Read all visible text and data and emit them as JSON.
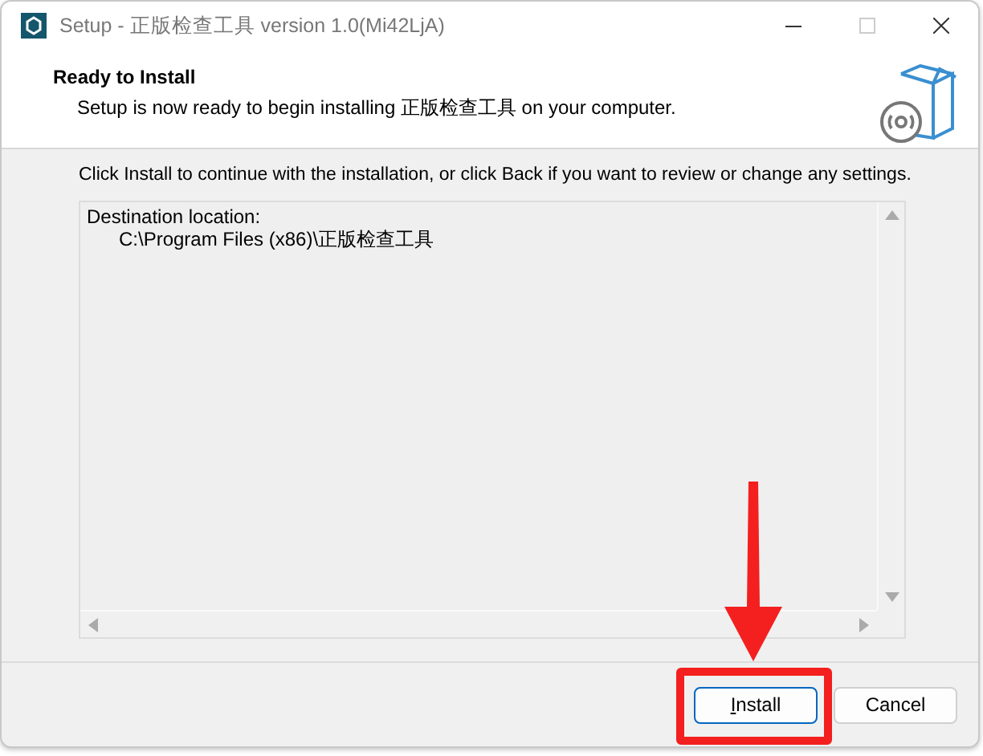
{
  "window": {
    "title": "Setup - 正版检查工具 version 1.0(Mi42LjA)"
  },
  "header": {
    "heading": "Ready to Install",
    "subtitle": "Setup is now ready to begin installing 正版检查工具 on your computer."
  },
  "instruction": "Click Install to continue with the installation, or click Back if you want to review or change any settings.",
  "memo": {
    "lines": [
      "Destination location:",
      "C:\\Program Files (x86)\\正版检查工具"
    ]
  },
  "buttons": [
    {
      "label": "Install",
      "kind": "default"
    },
    {
      "label": "Cancel",
      "kind": "normal"
    }
  ]
}
